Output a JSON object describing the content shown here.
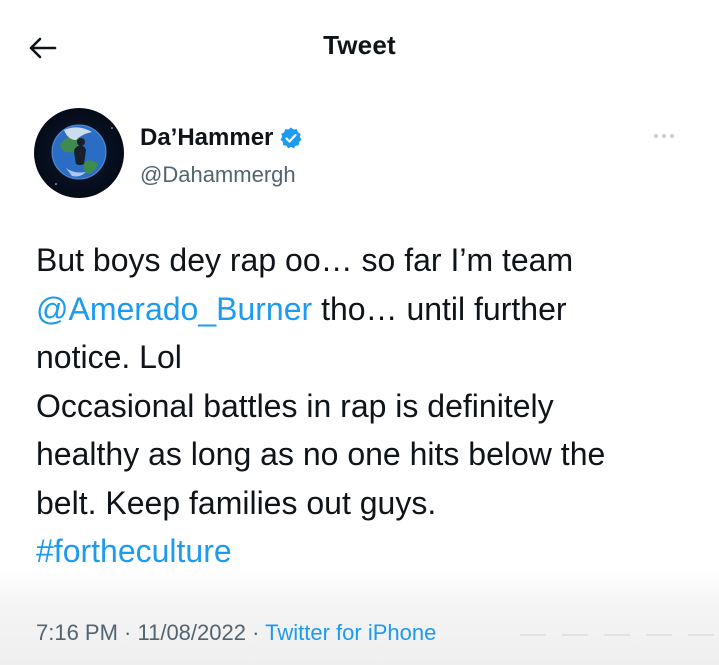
{
  "header": {
    "title": "Tweet",
    "back_icon": "arrow-left-icon"
  },
  "author": {
    "name": "Da’Hammer",
    "handle": "@Dahammergh",
    "verified_icon": "verified-badge-icon",
    "verified_color": "#1d9bf0"
  },
  "tweet": {
    "line1": "But boys dey rap oo… so far I’m team",
    "mention": "@Amerado_Burner",
    "line2_rest": " tho… until further",
    "line3": "notice. Lol",
    "line4": "Occasional battles in rap is definitely",
    "line5": "healthy as long as no one hits below the",
    "line6": "belt. Keep families out guys.",
    "hashtag": "#fortheculture"
  },
  "meta": {
    "time": "7:16 PM",
    "sep1": " · ",
    "date": "11/08/2022",
    "sep2": " · ",
    "source": "Twitter for iPhone"
  },
  "colors": {
    "link": "#1d9bf0",
    "text": "#0f1419",
    "secondary": "#536471"
  }
}
